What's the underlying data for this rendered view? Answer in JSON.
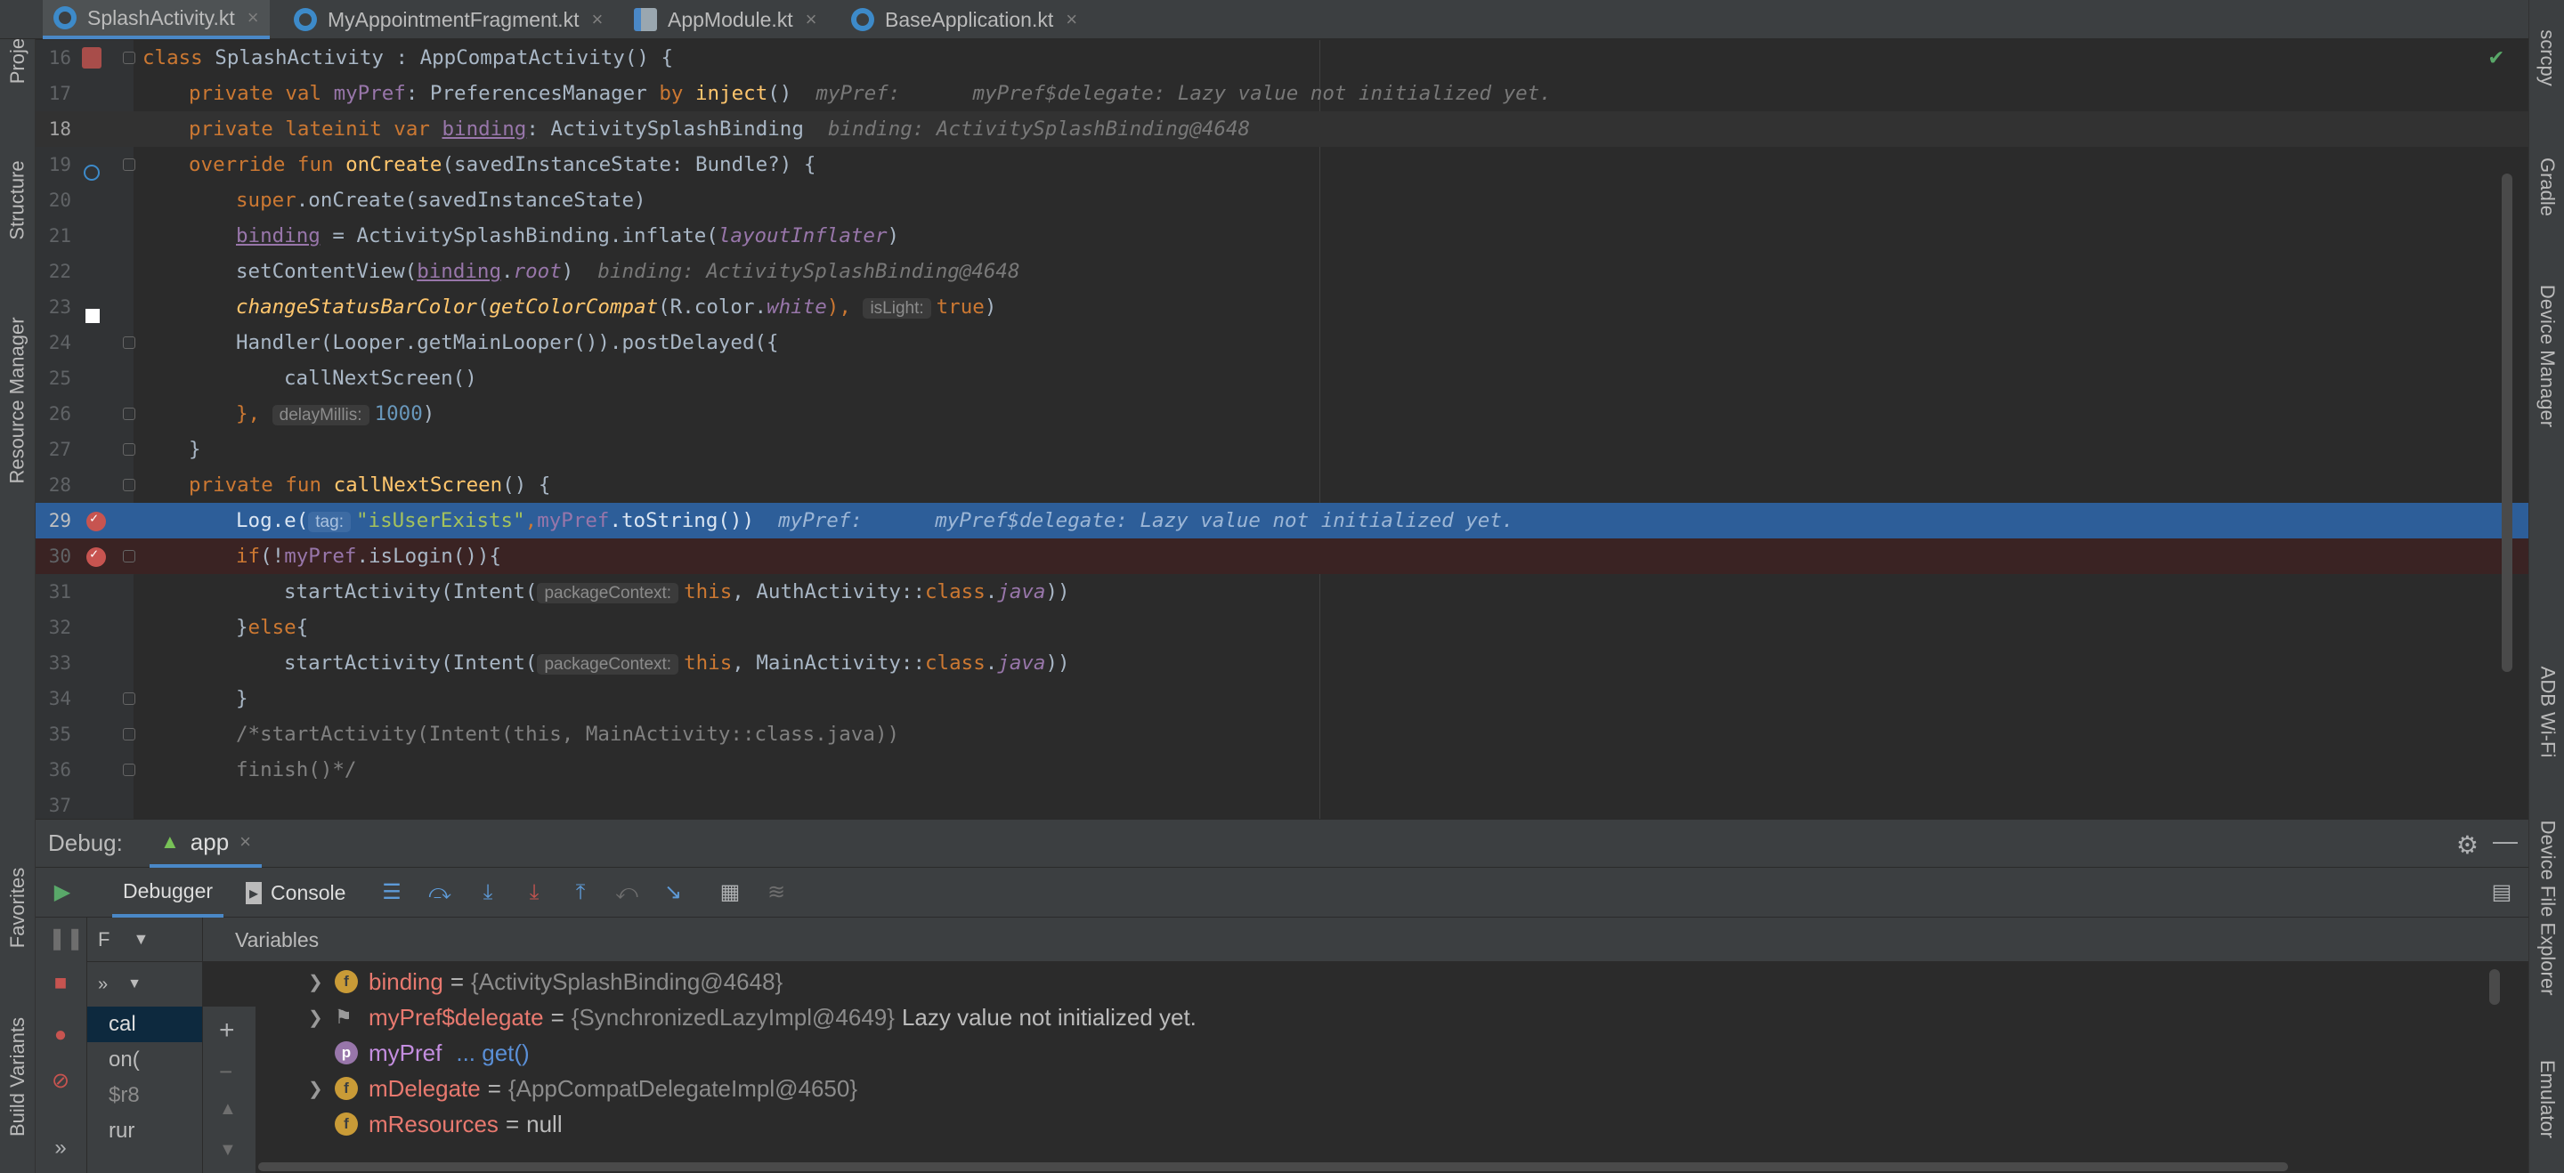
{
  "tabs": [
    {
      "label": "SplashActivity.kt",
      "icon": "kotlin-file-icon",
      "active": true
    },
    {
      "label": "MyAppointmentFragment.kt",
      "icon": "kotlin-file-icon",
      "active": false
    },
    {
      "label": "AppModule.kt",
      "icon": "module-file-icon",
      "active": false
    },
    {
      "label": "BaseApplication.kt",
      "icon": "kotlin-file-icon",
      "active": false
    }
  ],
  "left_tools": [
    "Project",
    "Structure",
    "Resource Manager",
    "Favorites",
    "Build Variants"
  ],
  "right_tools": [
    "scrcpy",
    "Gradle",
    "Device Manager",
    "ADB Wi-Fi",
    "Device File Explorer",
    "Emulator"
  ],
  "editor": {
    "lines": [
      {
        "n": "16"
      },
      {
        "n": "17"
      },
      {
        "n": "18"
      },
      {
        "n": "19"
      },
      {
        "n": "20"
      },
      {
        "n": "21"
      },
      {
        "n": "22"
      },
      {
        "n": "23"
      },
      {
        "n": "24"
      },
      {
        "n": "25"
      },
      {
        "n": "26"
      },
      {
        "n": "27"
      },
      {
        "n": "28"
      },
      {
        "n": "29"
      },
      {
        "n": "30"
      },
      {
        "n": "31"
      },
      {
        "n": "32"
      },
      {
        "n": "33"
      },
      {
        "n": "34"
      },
      {
        "n": "35"
      },
      {
        "n": "36"
      },
      {
        "n": "37"
      }
    ],
    "t": {
      "l16a": "class ",
      "l16b": "SplashActivity : AppCompatActivity() {",
      "l17a": "private val ",
      "l17b": "myPref",
      "l17c": ": PreferencesManager ",
      "l17d": "by ",
      "l17e": "inject",
      "l17f": "()",
      "l17inlay": "  myPref:      myPref$delegate: Lazy value not initialized yet.",
      "l18a": "private lateinit var ",
      "l18b": "binding",
      "l18c": ": ActivitySplashBinding",
      "l18inlay": "  binding: ActivitySplashBinding@4648",
      "l19a": "override fun ",
      "l19b": "onCreate",
      "l19c": "(savedInstanceState: Bundle?) {",
      "l20a": "super",
      "l20b": ".onCreate(savedInstanceState)",
      "l21a": "binding",
      "l21b": " = ActivitySplashBinding.inflate(",
      "l21c": "layoutInflater",
      "l21d": ")",
      "l22a": "setContentView(",
      "l22b": "binding",
      "l22c": ".",
      "l22d": "root",
      "l22e": ")",
      "l22inlay": "  binding: ActivitySplashBinding@4648",
      "l23a": "changeStatusBarColor",
      "l23b": "(",
      "l23c": "getColorCompat",
      "l23d": "(R.color.",
      "l23e": "white",
      "l23f": "), ",
      "l23hint": "isLight:",
      "l23g": "true",
      "l23h": ")",
      "l24a": "Handler(Looper.getMainLooper()).postDelayed({",
      "l25a": "callNextScreen()",
      "l26a": "}, ",
      "l26hint": "delayMillis:",
      "l26b": "1000",
      "l26c": ")",
      "l27a": "}",
      "l28a": "private fun ",
      "l28b": "callNextScreen",
      "l28c": "() {",
      "l29a": "Log.e(",
      "l29hint": "tag:",
      "l29b": "\"isUserExists\"",
      "l29c": ",",
      "l29d": "myPref",
      "l29e": ".toString())",
      "l29inlay": "  myPref:      myPref$delegate: Lazy value not initialized yet.",
      "l30a": "if",
      "l30b": "(!",
      "l30c": "myPref",
      "l30d": ".isLogin()){",
      "l31a": "startActivity(Intent(",
      "l31hint": "packageContext:",
      "l31b": "this",
      "l31c": ", AuthActivity::",
      "l31d": "class",
      "l31e": ".",
      "l31f": "java",
      "l31g": "))",
      "l32a": "}",
      "l32b": "else",
      "l32c": "{",
      "l33a": "startActivity(Intent(",
      "l33hint": "packageContext:",
      "l33b": "this",
      "l33c": ", MainActivity::",
      "l33d": "class",
      "l33e": ".",
      "l33f": "java",
      "l33g": "))",
      "l34a": "}",
      "l35a": "/*startActivity(Intent(this, MainActivity::class.java))",
      "l36a": "finish()*/"
    }
  },
  "debug": {
    "title": "Debug:",
    "app_tab": "app",
    "debugger_tab": "Debugger",
    "console_tab": "Console",
    "frames_header": "F",
    "frames": [
      "cal",
      "on(",
      "$r8",
      "rur"
    ],
    "variables_header": "Variables",
    "variables": [
      {
        "name": "binding",
        "value": "{ActivitySplashBinding@4648}",
        "extra": ""
      },
      {
        "name": "myPref$delegate",
        "value": "{SynchronizedLazyImpl@4649}",
        "extra": "Lazy value not initialized yet."
      },
      {
        "name": "myPref",
        "value": "... get()",
        "extra": ""
      },
      {
        "name": "mDelegate",
        "value": "{AppCompatDelegateImpl@4650}",
        "extra": ""
      },
      {
        "name": "mResources",
        "value": "null",
        "extra": ""
      }
    ]
  },
  "colors": {
    "accent": "#4a88c7",
    "selection": "#2d5e99",
    "breakpoint": "#c75450"
  }
}
